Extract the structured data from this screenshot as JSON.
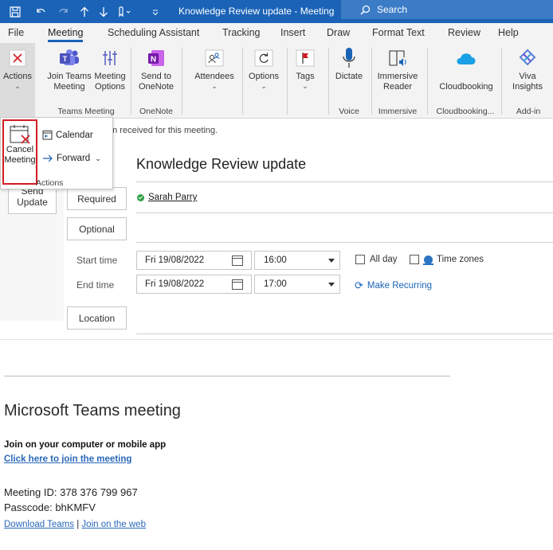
{
  "titlebar": {
    "title": "Knowledge Review update  -  Meeting",
    "search_label": "Search"
  },
  "menu": {
    "tabs": [
      "File",
      "Meeting",
      "Scheduling Assistant",
      "Tracking",
      "Insert",
      "Draw",
      "Format Text",
      "Review",
      "Help"
    ],
    "active": "Meeting"
  },
  "ribbon": {
    "actions": "Actions",
    "join_teams_1": "Join Teams",
    "join_teams_2": "Meeting",
    "meeting_options_1": "Meeting",
    "meeting_options_2": "Options",
    "send_onenote_1": "Send to",
    "send_onenote_2": "OneNote",
    "attendees": "Attendees",
    "options": "Options",
    "tags": "Tags",
    "dictate": "Dictate",
    "immersive_1": "Immersive",
    "immersive_2": "Reader",
    "cloudbooking": "Cloudbooking",
    "viva_1": "Viva",
    "viva_2": "Insights",
    "groups": {
      "teams_meeting": "Teams Meeting",
      "onenote": "OneNote",
      "voice": "Voice",
      "immersive": "Immersive",
      "cloudbooking": "Cloudbooking...",
      "addin": "Add-in"
    }
  },
  "popup": {
    "cancel_1": "Cancel",
    "cancel_2": "Meeting",
    "calendar": "Calendar",
    "forward": "Forward",
    "group": "Actions"
  },
  "form": {
    "info_bar": "en received for this meeting.",
    "send_1": "Send",
    "send_2": "Update",
    "subject": "Knowledge Review update",
    "required_label": "Required",
    "optional_label": "Optional",
    "attendee": "Sarah Parry",
    "start_label": "Start time",
    "end_label": "End time",
    "start_date": "Fri 19/08/2022",
    "start_time": "16:00",
    "end_date": "Fri 19/08/2022",
    "end_time": "17:00",
    "all_day": "All day",
    "time_zones": "Time zones",
    "make_recurring": "Make Recurring",
    "location_label": "Location"
  },
  "meeting_body": {
    "heading": "Microsoft Teams meeting",
    "join_head": "Join on your computer or mobile app",
    "join_link": "Click here to join the meeting",
    "meeting_id": "Meeting ID: 378 376 799 967",
    "passcode": "Passcode: bhKMFV",
    "download_teams": "Download Teams",
    "separator": "|",
    "join_web": "Join on the web"
  },
  "colors": {
    "accent": "#1a63b7",
    "highlight": "#d11c24",
    "link": "#2a68b9"
  }
}
